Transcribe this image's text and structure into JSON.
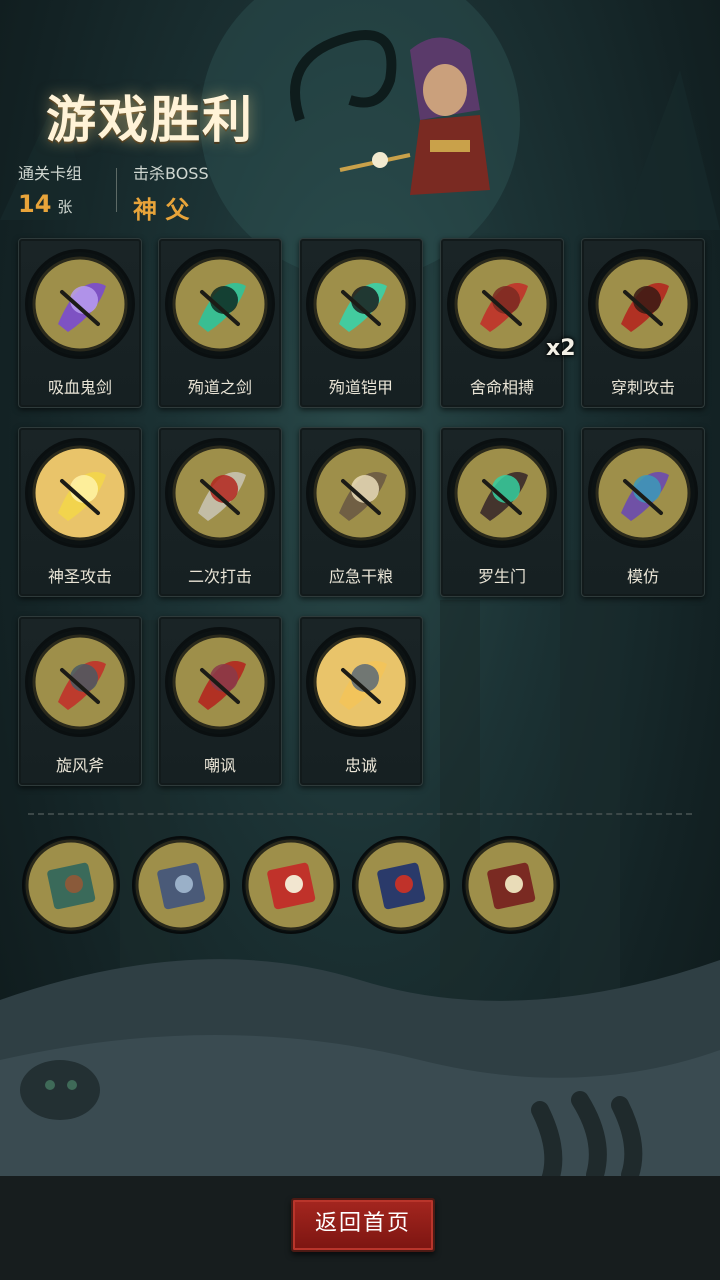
{
  "header": {
    "title": "游戏胜利",
    "stats": [
      {
        "label": "通关卡组",
        "value": "14",
        "unit": "张"
      },
      {
        "label": "击杀BOSS",
        "value": "神 父",
        "unit": ""
      }
    ]
  },
  "cards": [
    {
      "name": "吸血鬼剑",
      "icon": "vampire-sword-icon"
    },
    {
      "name": "殉道之剑",
      "icon": "martyr-sword-icon"
    },
    {
      "name": "殉道铠甲",
      "icon": "martyr-armor-icon"
    },
    {
      "name": "舍命相搏",
      "icon": "desperate-fight-icon",
      "count": "x2"
    },
    {
      "name": "穿刺攻击",
      "icon": "pierce-attack-icon"
    },
    {
      "name": "神圣攻击",
      "icon": "holy-attack-icon"
    },
    {
      "name": "二次打击",
      "icon": "double-strike-icon"
    },
    {
      "name": "应急干粮",
      "icon": "ration-icon"
    },
    {
      "name": "罗生门",
      "icon": "rashomon-icon"
    },
    {
      "name": "模仿",
      "icon": "mimic-icon"
    },
    {
      "name": "旋风斧",
      "icon": "whirlwind-axe-icon"
    },
    {
      "name": "嘲讽",
      "icon": "taunt-icon"
    },
    {
      "name": "忠诚",
      "icon": "loyalty-cross-icon"
    }
  ],
  "relics": [
    {
      "icon": "medal-banner-icon"
    },
    {
      "icon": "card-deck-icon"
    },
    {
      "icon": "clown-jester-icon"
    },
    {
      "icon": "red-book-icon"
    },
    {
      "icon": "skull-banner-sword-icon"
    }
  ],
  "footer": {
    "home_label": "返回首页"
  },
  "colors": {
    "accent": "#e8a43a",
    "button": "#a4261f",
    "medal": "#9e8f4a"
  }
}
